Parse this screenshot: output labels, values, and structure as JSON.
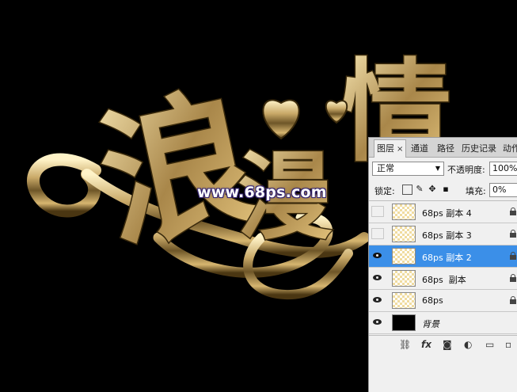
{
  "artwork": {
    "heading_glyphs": [
      "浪",
      "漫",
      "情"
    ],
    "watermark": "www.68ps.com"
  },
  "layers_panel": {
    "tabs": [
      {
        "label": "图层",
        "close": "×",
        "active": true
      },
      {
        "label": "通道",
        "active": false
      },
      {
        "label": "路径",
        "active": false
      },
      {
        "label": "历史记录",
        "active": false
      },
      {
        "label": "动作",
        "active": false
      }
    ],
    "blend_mode": "正常",
    "opacity_label": "不透明度:",
    "opacity_value": "100%",
    "lock_label": "锁定:",
    "fill_label": "填充:",
    "fill_value": "0%",
    "layers": [
      {
        "name": "68ps 副本 4",
        "visible": false,
        "selected": false,
        "locked": true
      },
      {
        "name": "68ps 副本 3",
        "visible": false,
        "selected": false,
        "locked": true
      },
      {
        "name": "68ps 副本 2",
        "visible": true,
        "selected": true,
        "locked": true
      },
      {
        "name": "68ps  副本",
        "visible": true,
        "selected": false,
        "locked": true
      },
      {
        "name": "68ps",
        "visible": true,
        "selected": false,
        "locked": true
      },
      {
        "name": "背景",
        "visible": true,
        "selected": false,
        "locked": false
      }
    ],
    "bottom_icons": [
      "link-icon",
      "fx-icon",
      "mask-icon",
      "adjustment-icon",
      "folder-icon",
      "new-layer-icon"
    ],
    "bottom_labels": {
      "fx": "fx"
    }
  },
  "colors": {
    "selection": "#3b8fe8",
    "gold": "#d8b866",
    "canvas": "#000000"
  }
}
